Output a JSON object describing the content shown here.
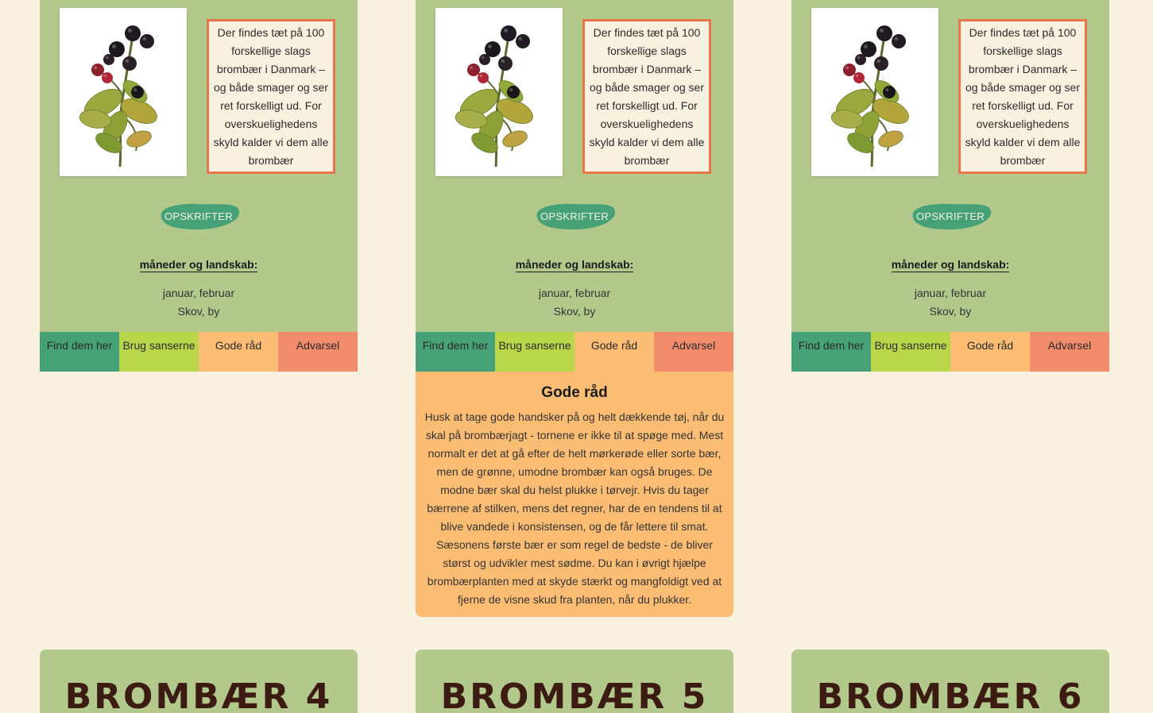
{
  "cards": [
    {
      "description": "Der findes tæt på 100 forskellige slags brombær i Danmark – og både smager og ser ret forskelligt ud. For overskuelighedens skyld kalder vi dem alle brombær",
      "recipe_label": "OPSKRIFTER",
      "months_title": "måneder og landskab:",
      "months": "januar, februar",
      "landscape": "Skov, by",
      "tabs": [
        "Find dem her",
        "Brug sanserne",
        "Gode råd",
        "Advarsel"
      ]
    },
    {
      "description": "Der findes tæt på 100 forskellige slags brombær i Danmark – og både smager og ser ret forskelligt ud. For overskuelighedens skyld kalder vi dem alle brombær",
      "recipe_label": "OPSKRIFTER",
      "months_title": "måneder og landskab:",
      "months": "januar, februar",
      "landscape": "Skov, by",
      "tabs": [
        "Find dem her",
        "Brug sanserne",
        "Gode råd",
        "Advarsel"
      ],
      "panel": {
        "title": "Gode råd",
        "text": "Husk at tage gode handsker på og helt dækkende tøj, når du skal på brombærjagt - tornene er ikke til at spøge med. Mest normalt er det at gå efter de helt mørkerøde eller sorte bær, men de grønne, umodne brombær kan også bruges. De modne bær skal du helst plukke i tørvejr. Hvis du tager bærrene af stilken, mens det regner, har de en tendens til at blive vandede i konsistensen, og de får lettere til smat. Sæsonens første bær er som regel de bedste - de bliver størst og udvikler mest sødme. Du kan i øvrigt hjælpe brombærplanten med at skyde stærkt og mangfoldigt ved at fjerne de visne skud fra planten, når du plukker."
      }
    },
    {
      "description": "Der findes tæt på 100 forskellige slags brombær i Danmark – og både smager og ser ret forskelligt ud. For overskuelighedens skyld kalder vi dem alle brombær",
      "recipe_label": "OPSKRIFTER",
      "months_title": "måneder og landskab:",
      "months": "januar, februar",
      "landscape": "Skov, by",
      "tabs": [
        "Find dem her",
        "Brug sanserne",
        "Gode råd",
        "Advarsel"
      ]
    }
  ],
  "bottom_cards": [
    "BROMBÆR 4",
    "BROMBÆR 5",
    "BROMBÆR 6"
  ],
  "colors": {
    "page_bg": "#f9f1e0",
    "card_bg": "#b3c98b",
    "accent_border": "#e8764a",
    "recipe_blob": "#46a177",
    "tab_find": "#46a177",
    "tab_senses": "#b9d64b",
    "tab_advice": "#fbbd73",
    "tab_warning": "#f28c6c",
    "heading_dark": "#3b1b12"
  },
  "icons": [
    "blackberry-photo",
    "recipe-blob-shape"
  ]
}
